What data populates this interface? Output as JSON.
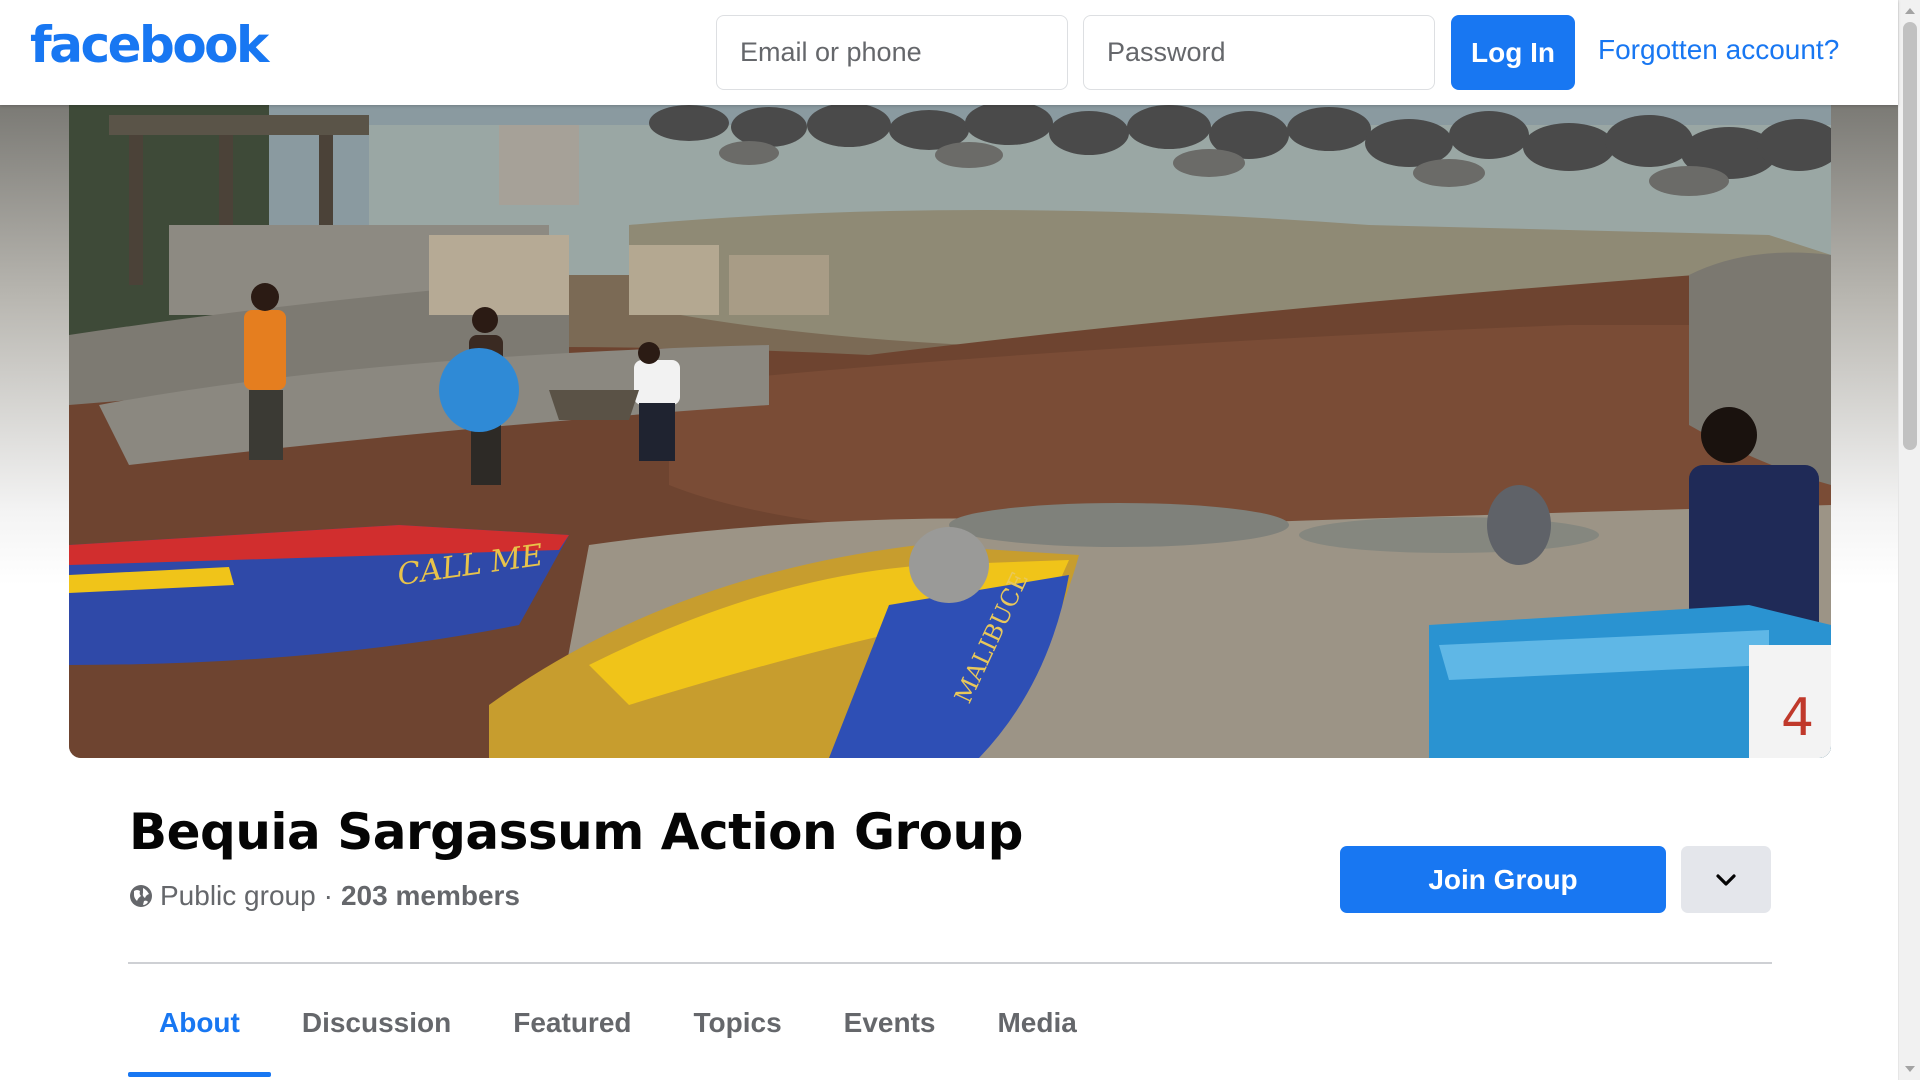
{
  "header": {
    "logo_text": "facebook",
    "email_placeholder": "Email or phone",
    "password_placeholder": "Password",
    "login_label": "Log In",
    "forgot_label": "Forgotten account?"
  },
  "group": {
    "name": "Bequia Sargassum Action Group",
    "privacy": "Public group",
    "separator": "·",
    "members": "203 members",
    "join_label": "Join Group"
  },
  "tabs": [
    {
      "label": "About",
      "active": true
    },
    {
      "label": "Discussion",
      "active": false
    },
    {
      "label": "Featured",
      "active": false
    },
    {
      "label": "Topics",
      "active": false
    },
    {
      "label": "Events",
      "active": false
    },
    {
      "label": "Media",
      "active": false
    }
  ],
  "cover": {
    "boat_label_1": "CALL ME",
    "boat_label_2": "MALIBUCE",
    "shirt_number": "4"
  },
  "icons": {
    "globe": "globe-icon",
    "chevron": "chevron-down-icon"
  },
  "colors": {
    "brand_blue": "#1877f2",
    "secondary_button_bg": "#e4e6eb",
    "muted_text": "#65676b"
  }
}
